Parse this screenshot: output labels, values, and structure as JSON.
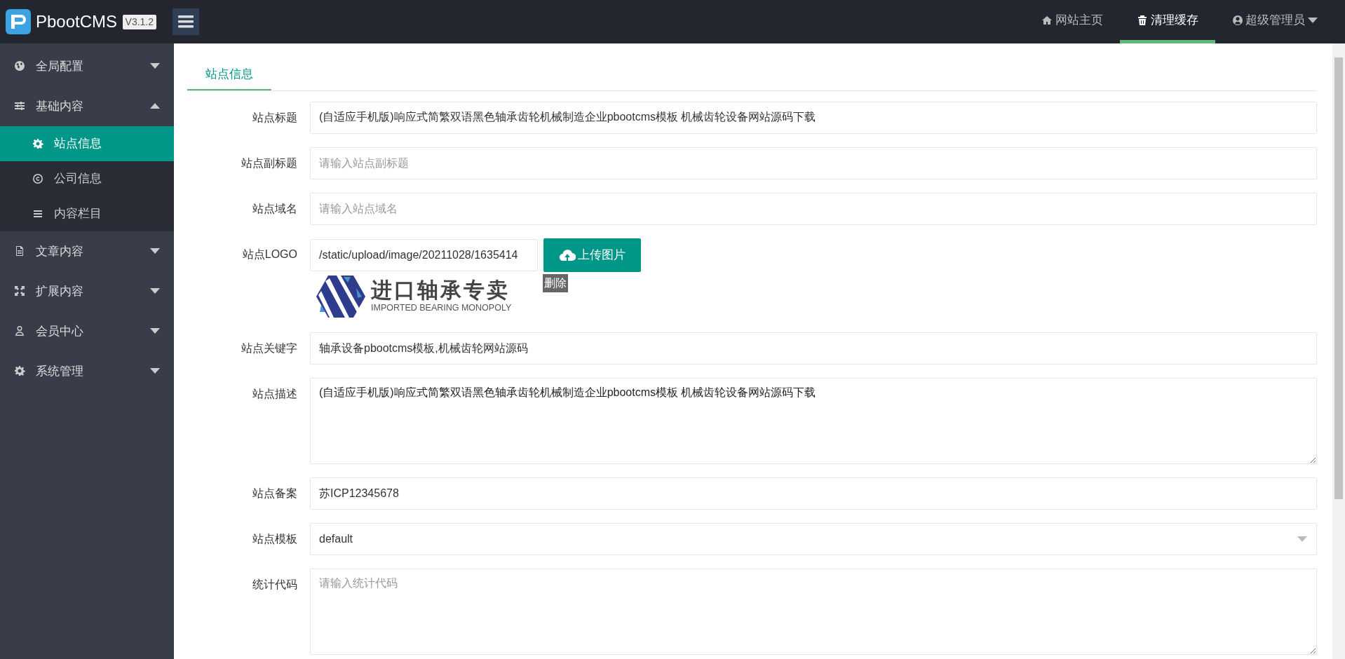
{
  "header": {
    "brand": "PbootCMS",
    "version": "V3.1.2",
    "nav": [
      {
        "label": "网站主页",
        "selected": false
      },
      {
        "label": "清理缓存",
        "selected": true
      },
      {
        "label": "超级管理员",
        "selected": false
      }
    ]
  },
  "sidebar": {
    "items": [
      {
        "label": "全局配置",
        "expanded": false
      },
      {
        "label": "基础内容",
        "expanded": true,
        "children": [
          {
            "label": "站点信息",
            "selected": true
          },
          {
            "label": "公司信息",
            "selected": false
          },
          {
            "label": "内容栏目",
            "selected": false
          }
        ]
      },
      {
        "label": "文章内容",
        "expanded": false
      },
      {
        "label": "扩展内容",
        "expanded": false
      },
      {
        "label": "会员中心",
        "expanded": false
      },
      {
        "label": "系统管理",
        "expanded": false
      }
    ]
  },
  "tabs": [
    {
      "label": "站点信息",
      "selected": true
    }
  ],
  "form": [
    {
      "kind": "text",
      "label": "站点标题",
      "value": "(自适应手机版)响应式简繁双语黑色轴承齿轮机械制造企业pbootcms模板 机械齿轮设备网站源码下载"
    },
    {
      "kind": "text",
      "label": "站点副标题",
      "placeholder": "请输入站点副标题"
    },
    {
      "kind": "text",
      "label": "站点域名",
      "placeholder": "请输入站点域名"
    },
    {
      "kind": "upload",
      "label": "站点LOGO",
      "value": "/static/upload/image/20211028/1635414",
      "button": "上传图片",
      "delete": "删除",
      "logo_title": "进口轴承专卖",
      "logo_subtitle": "IMPORTED BEARING MONOPOLY"
    },
    {
      "kind": "text",
      "label": "站点关键字",
      "value": "轴承设备pbootcms模板,机械齿轮网站源码"
    },
    {
      "kind": "textarea",
      "label": "站点描述",
      "value": "(自适应手机版)响应式简繁双语黑色轴承齿轮机械制造企业pbootcms模板 机械齿轮设备网站源码下载"
    },
    {
      "kind": "text",
      "label": "站点备案",
      "value": "苏ICP12345678"
    },
    {
      "kind": "select",
      "label": "站点模板",
      "value": "default"
    },
    {
      "kind": "textarea",
      "label": "统计代码",
      "placeholder": "请输入统计代码"
    }
  ]
}
